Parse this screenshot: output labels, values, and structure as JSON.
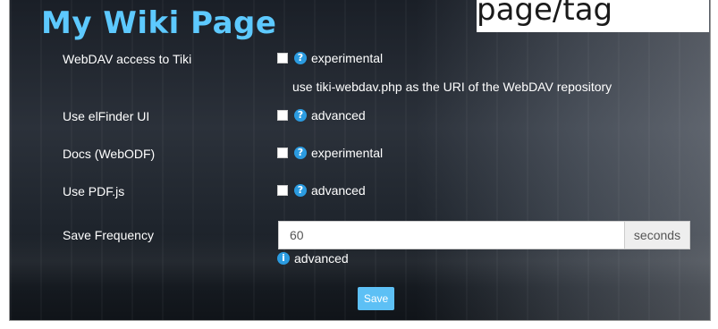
{
  "header": {
    "site_title": "My Wiki Page",
    "right_text": "page/tag"
  },
  "settings": [
    {
      "label": "WebDAV access to Tiki",
      "badge": "experimental",
      "checked": false
    },
    {
      "label": "Use elFinder UI",
      "badge": "advanced",
      "checked": false
    },
    {
      "label": "Docs (WebODF)",
      "badge": "experimental",
      "checked": false
    },
    {
      "label": "Use PDF.js",
      "badge": "advanced",
      "checked": false
    }
  ],
  "webdav_hint": "use tiki-webdav.php as the URI of the WebDAV repository",
  "save_frequency": {
    "label": "Save Frequency",
    "value": "60",
    "unit": "seconds",
    "badge": "advanced"
  },
  "save_button": "Save",
  "icons": {
    "help": "question-circle-icon",
    "info": "info-circle-icon"
  },
  "colors": {
    "accent": "#5dc9ff",
    "button": "#5dc0f5",
    "icon": "#2b9be0"
  }
}
